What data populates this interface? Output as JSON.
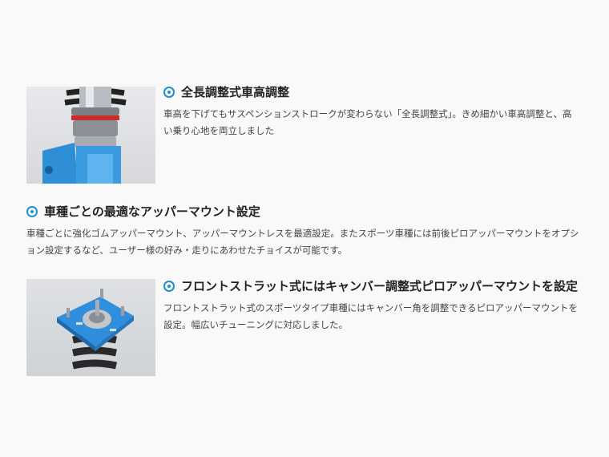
{
  "sections": [
    {
      "title": "全長調整式車高調整",
      "body": "車高を下げてもサスペンションストロークが変わらない「全長調整式」。きめ細かい車高調整と、高い乗り心地を両立しました"
    },
    {
      "title": "車種ごとの最適なアッパーマウント設定",
      "body": "車種ごとに強化ゴムアッパーマウント、アッパーマウントレスを最適設定。またスポーツ車種には前後ピロアッパーマウントをオプション設定するなど、ユーザー様の好み・走りにあわせたチョイスが可能です。"
    },
    {
      "title": "フロントストラット式にはキャンバー調整式ピロアッパーマウントを設定",
      "body": "フロントストラット式のスポーツタイプ車種にはキャンバー角を調整できるピロアッパーマウントを設定。幅広いチューニングに対応しました。"
    }
  ],
  "colors": {
    "accent": "#1a8fd0",
    "background": "#f9f9f9",
    "part_blue": "#2e8fd6"
  }
}
